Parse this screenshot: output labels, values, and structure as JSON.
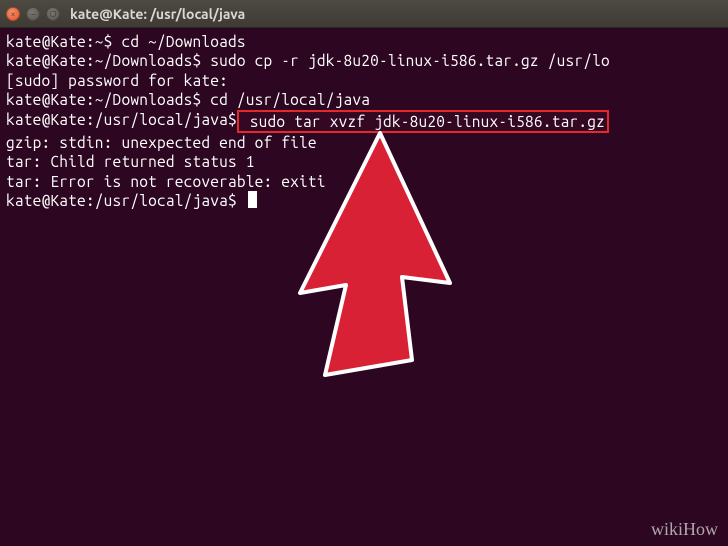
{
  "window": {
    "title": "kate@Kate: /usr/local/java"
  },
  "lines": {
    "l1_prompt": "kate@Kate:~$",
    "l1_cmd": " cd ~/Downloads",
    "l2_prompt": "kate@Kate:~/Downloads$",
    "l2_cmd": " sudo cp -r jdk-8u20-linux-i586.tar.gz /usr/lo",
    "l3": "[sudo] password for kate:",
    "l4_prompt": "kate@Kate:~/Downloads$",
    "l4_cmd": " cd /usr/local/java",
    "l5_prompt": "kate@Kate:/usr/local/java$",
    "l5_cmd": " sudo tar xvzf jdk-8u20-linux-i586.tar.gz",
    "l6": "",
    "l7": "gzip: stdin: unexpected end of file",
    "l8": "tar: Child returned status 1",
    "l9": "tar: Error is not recoverable: exiti",
    "l10_prompt": "kate@Kate:/usr/local/java$"
  },
  "colors": {
    "terminal_bg": "#2d0722",
    "highlight": "#e3292b",
    "arrow_fill": "#d92135",
    "arrow_stroke": "#ffffff"
  },
  "watermark": "wikiHow"
}
